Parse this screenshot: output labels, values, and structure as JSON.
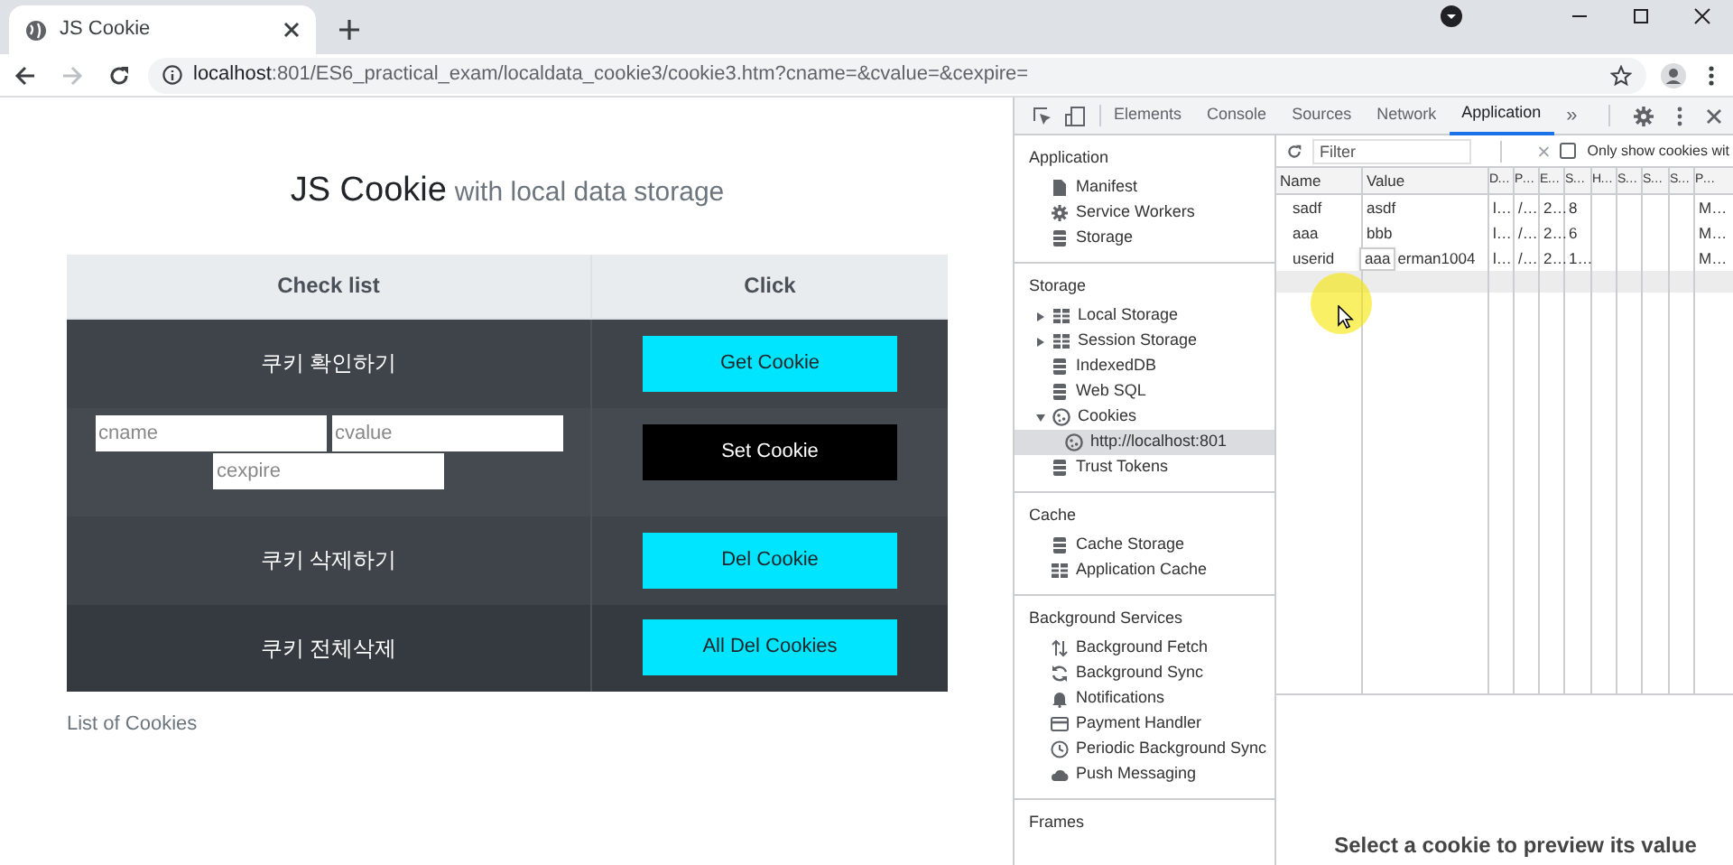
{
  "browser": {
    "tab": {
      "title": "JS Cookie"
    },
    "address": {
      "host": "localhost",
      "path": ":801/ES6_practical_exam/localdata_cookie3/cookie3.htm?cname=&cvalue=&cexpire="
    }
  },
  "page": {
    "title": "JS Cookie",
    "subtitle": "with local data storage",
    "table": {
      "columns": [
        "Check list",
        "Click"
      ],
      "rows": [
        {
          "kind": "label",
          "label": "쿠키 확인하기",
          "button": {
            "label": "Get Cookie"
          }
        },
        {
          "kind": "inputs",
          "inputs": [
            {
              "placeholder": "cname"
            },
            {
              "placeholder": "cvalue"
            },
            {
              "placeholder": "cexpire"
            }
          ],
          "button": {
            "label": "Set Cookie"
          }
        },
        {
          "kind": "label",
          "label": "쿠키 삭제하기",
          "button": {
            "label": "Del Cookie"
          }
        },
        {
          "kind": "label",
          "label": "쿠키 전체삭제",
          "button": {
            "label": "All Del Cookies"
          }
        }
      ]
    },
    "footer": "List of Cookies"
  },
  "devtools": {
    "tabs": [
      {
        "label": "Elements",
        "selected": false
      },
      {
        "label": "Console",
        "selected": false
      },
      {
        "label": "Sources",
        "selected": false
      },
      {
        "label": "Network",
        "selected": false
      },
      {
        "label": "Application",
        "selected": true
      }
    ],
    "more": "»",
    "sidebar": [
      {
        "title": "Application",
        "items": [
          {
            "label": "Manifest"
          },
          {
            "label": "Service Workers"
          },
          {
            "label": "Storage"
          }
        ]
      },
      {
        "title": "Storage",
        "items": [
          {
            "label": "Local Storage",
            "expanded": false
          },
          {
            "label": "Session Storage",
            "expanded": false
          },
          {
            "label": "IndexedDB"
          },
          {
            "label": "Web SQL"
          },
          {
            "label": "Cookies",
            "expanded": true,
            "children": [
              {
                "label": "http://localhost:801",
                "selected": true
              }
            ]
          },
          {
            "label": "Trust Tokens"
          }
        ]
      },
      {
        "title": "Cache",
        "items": [
          {
            "label": "Cache Storage"
          },
          {
            "label": "Application Cache"
          }
        ]
      },
      {
        "title": "Background Services",
        "items": [
          {
            "label": "Background Fetch"
          },
          {
            "label": "Background Sync"
          },
          {
            "label": "Notifications"
          },
          {
            "label": "Payment Handler"
          },
          {
            "label": "Periodic Background Sync"
          },
          {
            "label": "Push Messaging"
          }
        ]
      },
      {
        "title": "Frames"
      }
    ],
    "filter": {
      "placeholder": "Filter"
    },
    "only_show": {
      "label": "Only show cookies wit",
      "checked": false
    },
    "cookies": {
      "columns": [
        "Name",
        "Value",
        "D…",
        "P…",
        "E…",
        "S…",
        "H…",
        "S…",
        "S…",
        "S…",
        "P…"
      ],
      "rows": [
        {
          "cells": [
            "sadf",
            "asdf",
            "l…",
            "/…",
            "2…",
            "8",
            "",
            "",
            "",
            "",
            "M…"
          ]
        },
        {
          "cells": [
            "aaa",
            "bbb",
            "l…",
            "/…",
            "2…",
            "6",
            "",
            "",
            "",
            "",
            "M…"
          ]
        },
        {
          "cells": [
            "userid",
            "erman1004",
            "l…",
            "/…",
            "2…",
            "1…",
            "",
            "",
            "",
            "",
            "M…"
          ],
          "tooltip": "aaa"
        }
      ]
    },
    "preview": "Select a cookie to preview its value"
  }
}
